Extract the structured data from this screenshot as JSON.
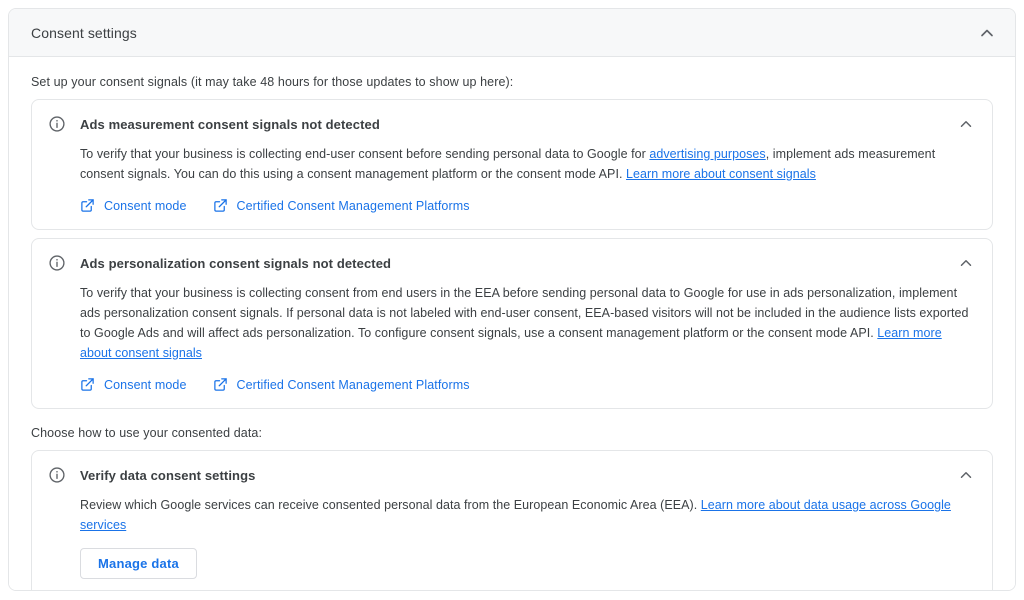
{
  "panel": {
    "title": "Consent settings",
    "collapse_icon": "chevron-up-icon"
  },
  "body": {
    "setup_label": "Set up your consent signals (it may take 48 hours for those updates to show up here):",
    "choose_label": "Choose how to use your consented data:"
  },
  "cards": [
    {
      "id": "ads-measurement",
      "icon": "info-icon",
      "title": "Ads measurement consent signals not detected",
      "collapse_icon": "chevron-up-icon",
      "text_part1": "To verify that your business is collecting end-user consent before sending personal data to Google for ",
      "link_inline": "advertising purposes",
      "text_part2": ", implement ads measurement consent signals. You can do this using a consent management platform or the consent mode API. ",
      "link_learn_more": "Learn more about consent signals",
      "links": [
        {
          "icon": "open-in-new-icon",
          "label": "Consent mode"
        },
        {
          "icon": "open-in-new-icon",
          "label": "Certified Consent Management Platforms"
        }
      ]
    },
    {
      "id": "ads-personalization",
      "icon": "info-icon",
      "title": "Ads personalization consent signals not detected",
      "collapse_icon": "chevron-up-icon",
      "text_part1": "To verify that your business is collecting consent from end users in the EEA before sending personal data to Google for use in ads personalization, implement ads personalization consent signals. If personal data is not labeled with end-user consent, EEA-based visitors will not be included in the audience lists exported to Google Ads and will affect ads personalization. To configure consent signals, use a consent management platform or the consent mode API. ",
      "link_learn_more": "Learn more about consent signals",
      "links": [
        {
          "icon": "open-in-new-icon",
          "label": "Consent mode"
        },
        {
          "icon": "open-in-new-icon",
          "label": "Certified Consent Management Platforms"
        }
      ]
    }
  ],
  "verify_card": {
    "id": "verify-data-consent",
    "icon": "info-icon",
    "title": "Verify data consent settings",
    "collapse_icon": "chevron-up-icon",
    "text_part1": "Review which Google services can receive consented personal data from the European Economic Area (EEA). ",
    "link_learn_more": "Learn more about data usage across Google services",
    "button_label": "Manage data"
  },
  "colors": {
    "link": "#1a73e8",
    "text": "#3c4043",
    "border": "#e4e6e8",
    "header_bg": "#f7f8f9",
    "icon": "#5f6368"
  }
}
